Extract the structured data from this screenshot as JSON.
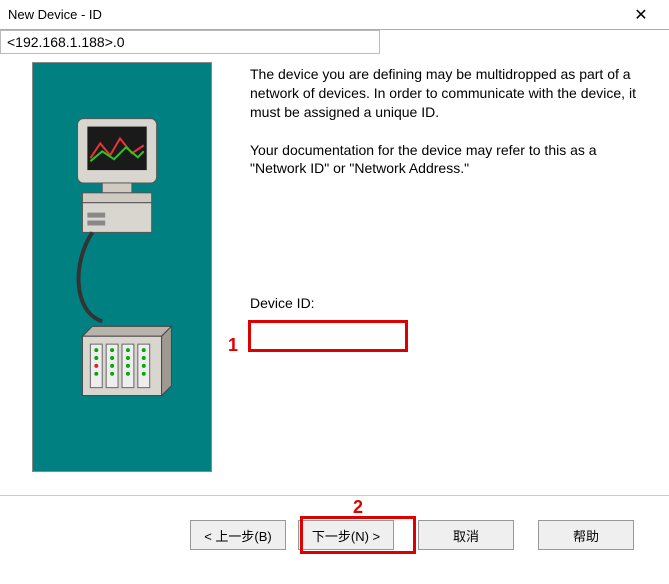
{
  "window": {
    "title": "New Device - ID",
    "close_glyph": "✕"
  },
  "description": {
    "para1": "The device you are defining may be multidropped as part of a network of devices.  In order to communicate with the device, it must be assigned a unique ID.",
    "para2": "Your documentation for the device may refer to this as a \"Network ID\" or \"Network Address.\""
  },
  "form": {
    "device_id_label": "Device ID:",
    "device_id_value": "<192.168.1.188>.0"
  },
  "annotations": {
    "mark1": "1",
    "mark2": "2",
    "highlight_color": "#d00000"
  },
  "buttons": {
    "back": "< 上一步(B)",
    "next": "下一步(N) >",
    "cancel": "取消",
    "help": "帮助"
  }
}
